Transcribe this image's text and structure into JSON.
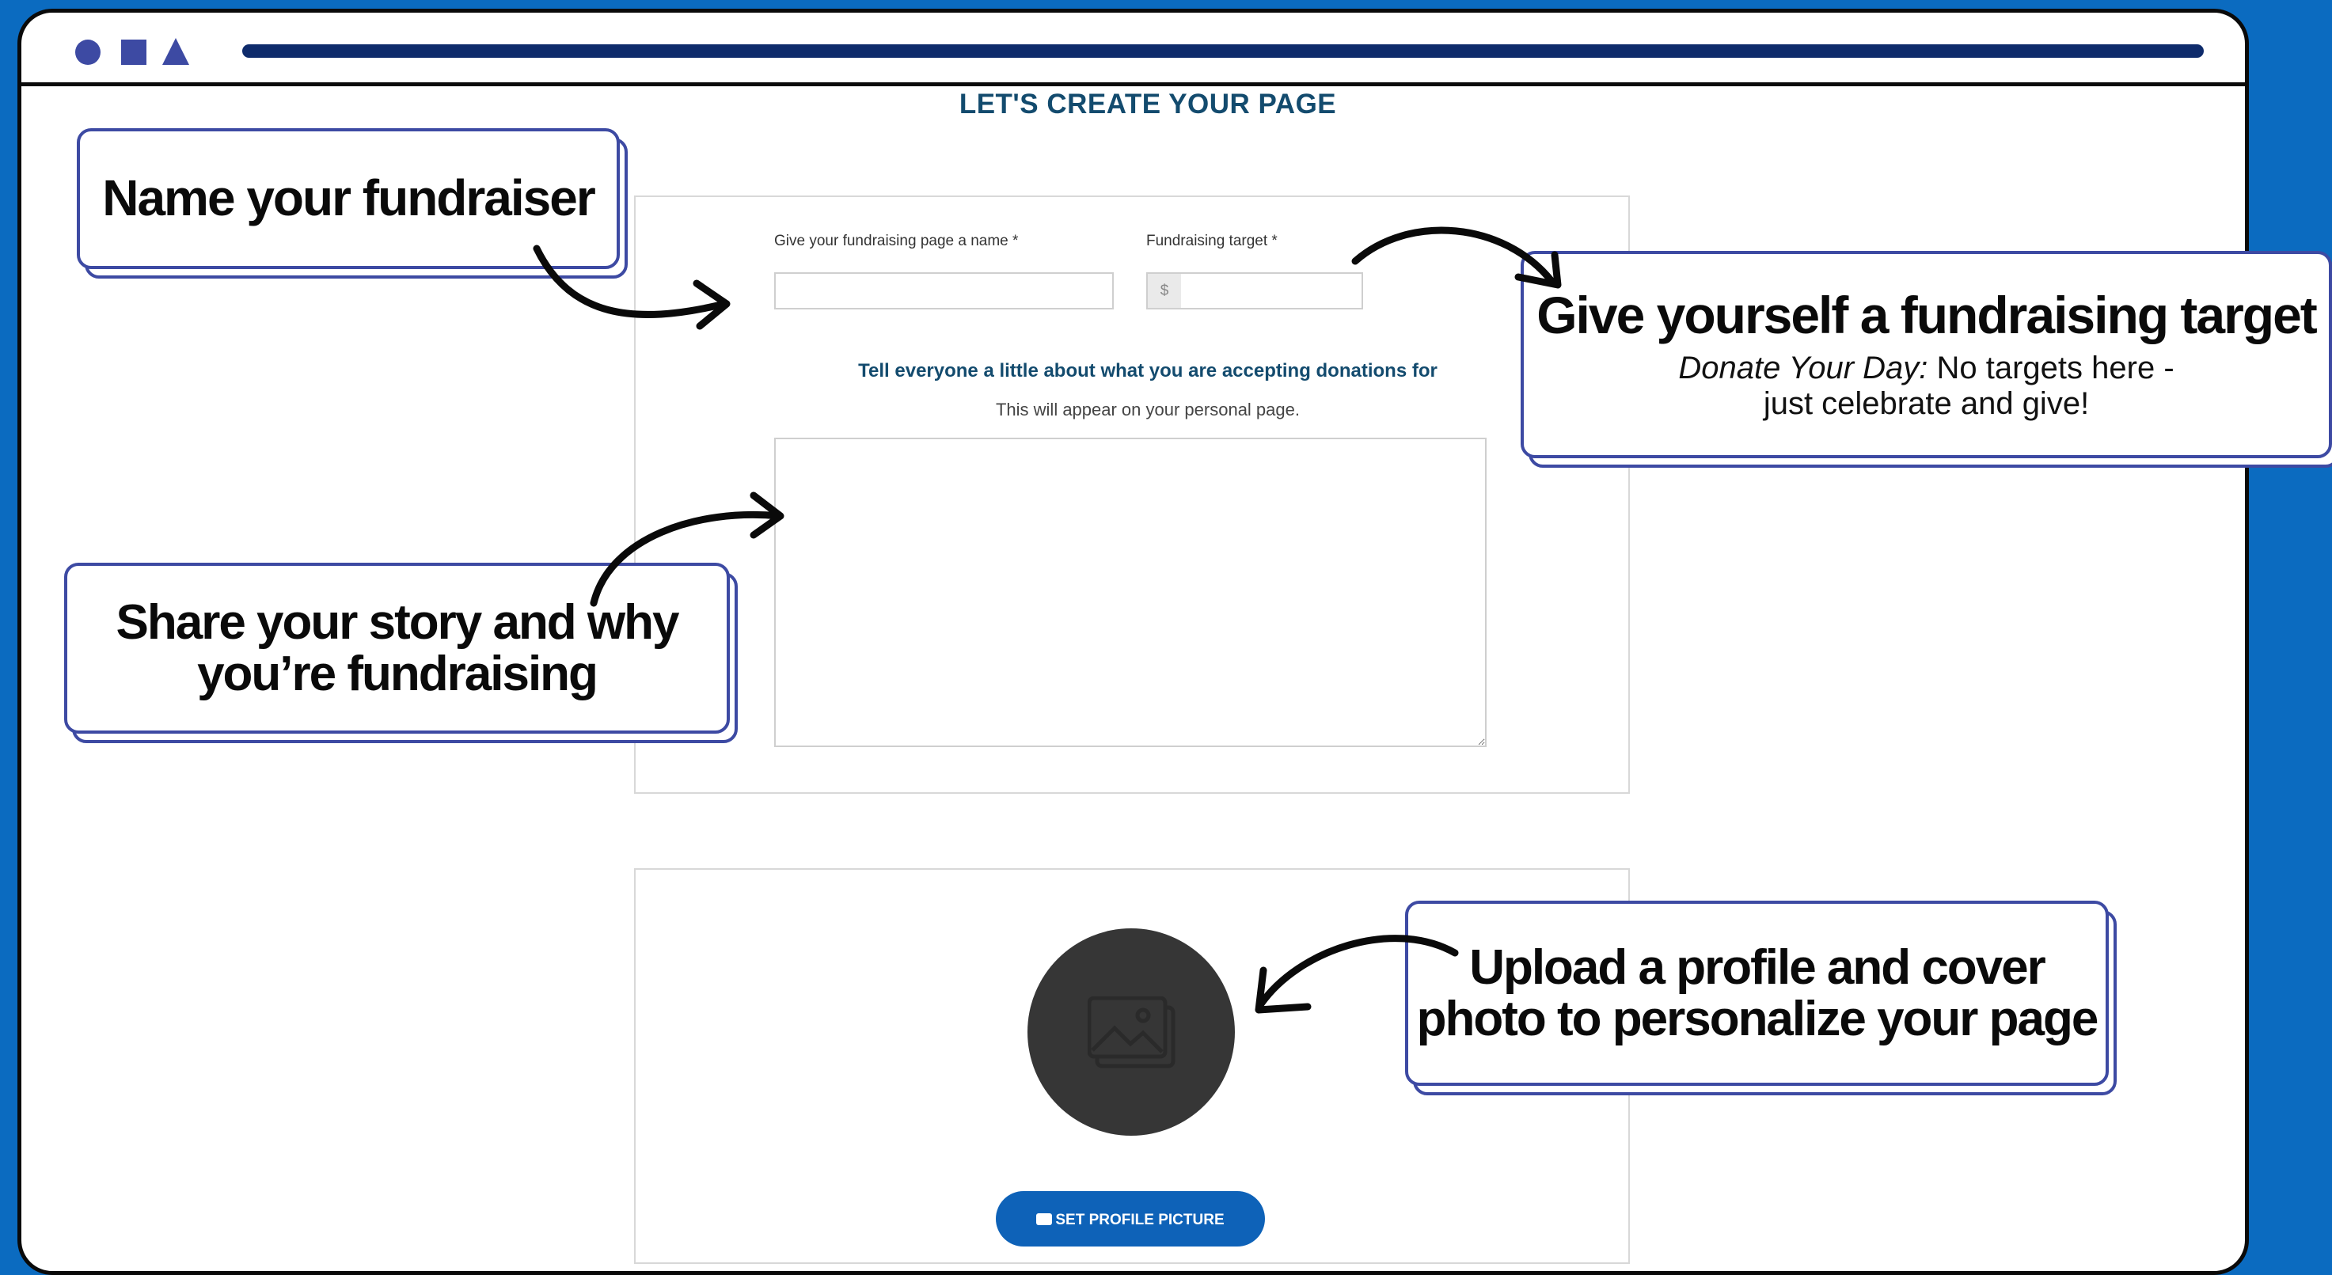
{
  "window": {
    "title_controls": [
      "circle-shape",
      "square-shape",
      "triangle-shape"
    ]
  },
  "page": {
    "title": "LET'S CREATE YOUR PAGE"
  },
  "form": {
    "name_label": "Give your fundraising page a name *",
    "name_value": "",
    "target_label": "Fundraising target *",
    "target_prefix": "$",
    "target_value": "",
    "story_heading": "Tell everyone a little about what you are accepting donations for",
    "story_subtext": "This will appear on your personal page.",
    "story_value": ""
  },
  "profile": {
    "avatar_icon": "image-icon",
    "button_label": "SET PROFILE PICTURE",
    "button_icon": "camera-icon"
  },
  "callouts": {
    "name": "Name your fundraiser",
    "target_title": "Give yourself a fundraising target",
    "target_note_italic": "Donate Your Day:",
    "target_note_line1": " No targets here -",
    "target_note_line2": "just celebrate and give!",
    "story_line1": "Share your story and why",
    "story_line2": "you’re fundraising",
    "upload_line1": "Upload a profile and cover",
    "upload_line2": "photo to personalize your page"
  },
  "colors": {
    "background": "#0b6bc0",
    "callout_border": "#3d4aa3",
    "heading_text": "#134b6e",
    "button": "#0e62b8",
    "url_bar": "#0e2b6b"
  }
}
